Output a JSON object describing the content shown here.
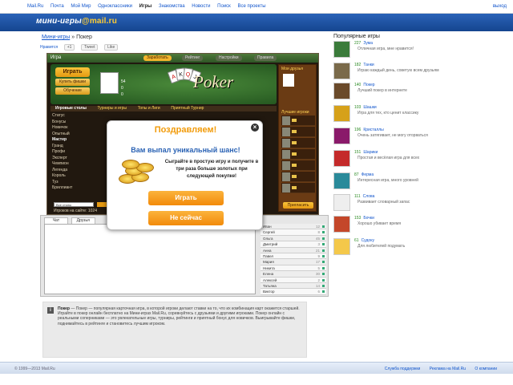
{
  "topnav": {
    "items": [
      "Mail.Ru",
      "Почта",
      "Мой Мир",
      "Одноклассники",
      "Игры",
      "Знакомства",
      "Новости",
      "Поиск",
      "Все проекты"
    ],
    "active_index": 4,
    "exit": "выход"
  },
  "logo": {
    "text": "мини-игры",
    "brand": "@mail.ru"
  },
  "breadcrumb": {
    "link": "Мини-игры",
    "separator": "»",
    "current": "Покер"
  },
  "share": {
    "label": "Нравится",
    "gplus": "+1",
    "tweet": "Tweet",
    "fb": "Like"
  },
  "game": {
    "topbar_left": "Игра",
    "topbar_pills": [
      "Заработать",
      "Рейтинг",
      "Настройки",
      "Правила"
    ],
    "play": "Играть",
    "small_buttons": [
      "Купить фишки",
      "Обучение"
    ],
    "stat_lines": [
      "54",
      "0",
      "0"
    ],
    "logo_text": "Poker",
    "cards": [
      "A",
      "K",
      "Q",
      "J"
    ],
    "tabs": [
      "Игровые столы",
      "Турниры и игры",
      "Топы и Лиги",
      "Приятный Турнир"
    ],
    "active_tab_index": 0,
    "left_list": [
      "Статус",
      "Бонусы",
      "Новичок",
      "Опытный",
      "Мастер",
      "Гранд",
      "Профи",
      "Эксперт",
      "Чемпион",
      "Легенда",
      "Король",
      "Туз",
      "Бриллиант"
    ],
    "left_highlight_index": 4,
    "dropdown": "Все столы",
    "counter": "Игроков на сайте: 1024",
    "right_panel": {
      "title": "Мои друзья",
      "friends_title": "Лучшие игроки",
      "button": "Пригласить"
    }
  },
  "chat": {
    "tabs": [
      "Чат",
      "Друзья"
    ],
    "players": [
      "Иван",
      "Сергей",
      "Ольга",
      "Дмитрий",
      "Анна",
      "Павел",
      "Мария",
      "Никита",
      "Елена",
      "Алексей",
      "Татьяна",
      "Виктор"
    ],
    "player_values": [
      "12",
      "8",
      "45",
      "3",
      "21",
      "9",
      "17",
      "5",
      "30",
      "2",
      "14",
      "6"
    ]
  },
  "modal": {
    "title": "Поздравляем!",
    "subtitle": "Вам выпал уникальный шанс!",
    "body": "Сыграйте в простую игру и получите в три раза больше золотых при следующей покупке!",
    "play": "Играть",
    "decline": "Не сейчас",
    "close": "×"
  },
  "popular": {
    "heading": "Популярные игры",
    "items": [
      {
        "score": "227",
        "name": "Зума",
        "text": "Отличная игра, мне нравится!",
        "color": "#3a7b3a"
      },
      {
        "score": "182",
        "name": "Танки",
        "text": "Играю каждый день, советую всем друзьям",
        "color": "#7a6a4a"
      },
      {
        "score": "140",
        "name": "Покер",
        "text": "Лучший покер в интернете",
        "color": "#6a4a2a"
      },
      {
        "score": "103",
        "name": "Шашки",
        "text": "Игра для тех, кто ценит классику",
        "color": "#d6a11a"
      },
      {
        "score": "196",
        "name": "Кристаллы",
        "text": "Очень затягивает, не могу оторваться",
        "color": "#8a1a6a"
      },
      {
        "score": "151",
        "name": "Шарики",
        "text": "Простая и весёлая игра для всех",
        "color": "#c42a2a"
      },
      {
        "score": "87",
        "name": "Ферма",
        "text": "Интересная игра, много уровней",
        "color": "#2a8a9a"
      },
      {
        "score": "111",
        "name": "Слова",
        "text": "Развивает словарный запас",
        "color": "#eee"
      },
      {
        "score": "153",
        "name": "Бочки",
        "text": "Хорошо убивает время",
        "color": "#c4472a"
      },
      {
        "score": "61",
        "name": "Судоку",
        "text": "Для любителей подумать",
        "color": "#f4c84a"
      }
    ]
  },
  "description": {
    "title": "Покер",
    "text": "Покер — популярная карточная игра, в которой игроки делают ставки на то, что их комбинация карт окажется старшей. Играйте в покер онлайн бесплатно на Мини-играх Mail.Ru, соревнуйтесь с друзьями и другими игроками. Покер онлайн с реальными соперниками — это увлекательные игры, турниры, рейтинги и приятный бонус для новичков. Выигрывайте фишки, поднимайтесь в рейтинге и становитесь лучшим игроком."
  },
  "footer": {
    "copyright": "© 1999—2013 Mail.Ru",
    "links": [
      "Служба поддержки",
      "Реклама на Mail.Ru",
      "О компании"
    ]
  }
}
